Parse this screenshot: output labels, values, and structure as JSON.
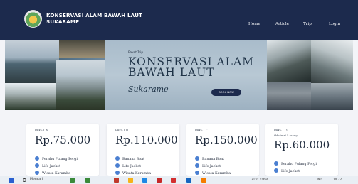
{
  "navbar": {
    "brand_line1": "KONSERVASI ALAM BAWAH LAUT",
    "brand_line2": "SUKARAME",
    "links": [
      "Home",
      "Article",
      "Trip",
      "Login"
    ]
  },
  "hero": {
    "kicker": "Paket Trip",
    "title_line1": "KONSERVASI ALAM",
    "title_line2": "BAWAH LAUT",
    "script": "Sukarame",
    "button": "BOOK NOW"
  },
  "packages": [
    {
      "label": "PAKET A",
      "price": "Rp.75.000",
      "items": [
        "Perahu Pulang Pergi",
        "Life Jacket",
        "Wisata Karamba"
      ]
    },
    {
      "label": "PAKET B",
      "price": "Rp.110.000",
      "items": [
        "Banana Boat",
        "Life Jacket",
        "Wisata Karamba"
      ]
    },
    {
      "label": "PAKET C",
      "price": "Rp.150.000",
      "items": [
        "Banana Boat",
        "Life Jacket",
        "Wisata Karamba"
      ]
    },
    {
      "label": "PAKET D",
      "note": "*Minimal 5 orang",
      "price": "Rp.60.000",
      "items": [
        "Perahu Pulang Pergi",
        "Life Jacket"
      ]
    }
  ],
  "taskbar": {
    "search_placeholder": "Mencari",
    "weather": "31°C Kabut",
    "lang": "IND",
    "time": "10.32"
  },
  "colors": {
    "navbar": "#1c2a4d",
    "accent": "#4a7fd1",
    "background": "#f3f4f8"
  }
}
